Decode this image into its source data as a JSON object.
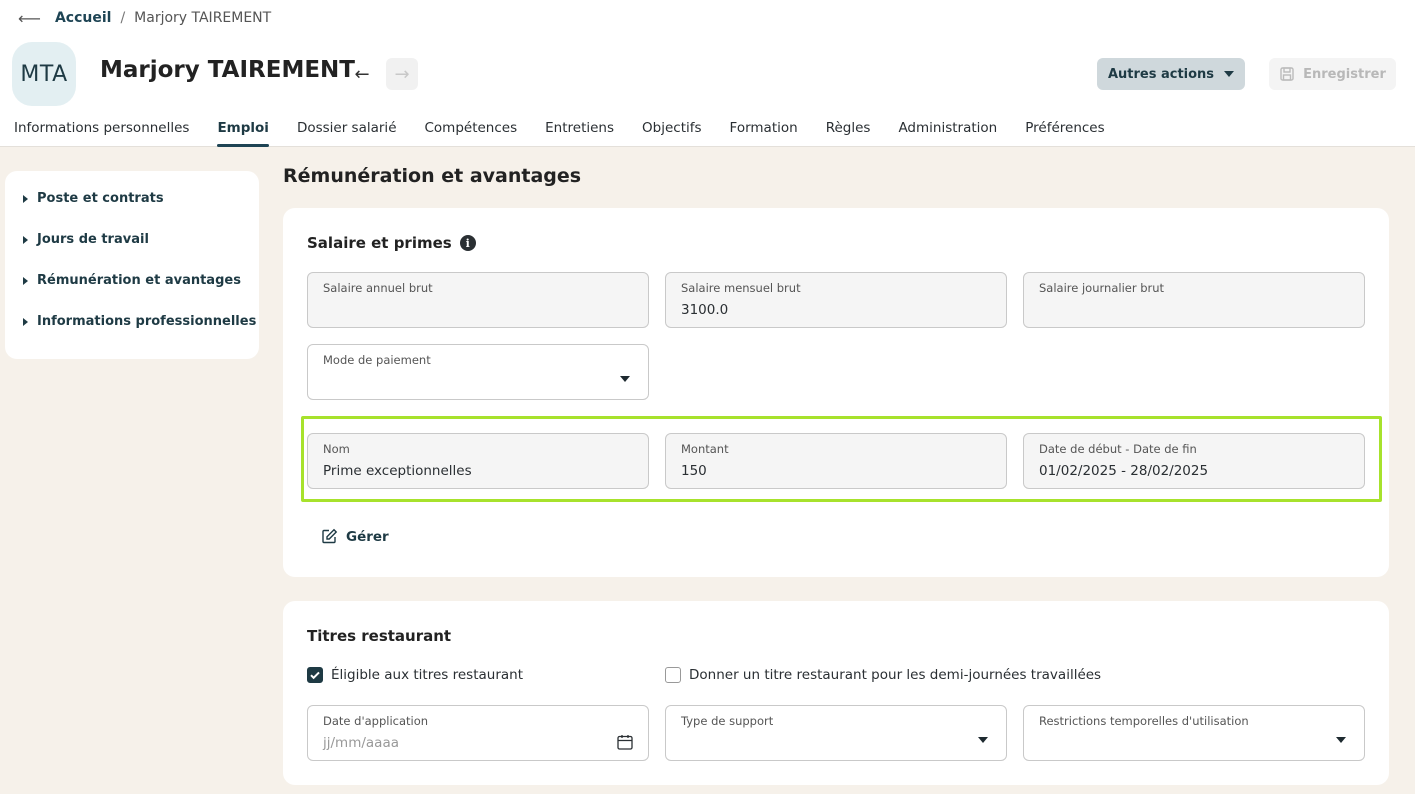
{
  "breadcrumb": {
    "home": "Accueil",
    "separator": "/",
    "current": "Marjory TAIREMENT"
  },
  "header": {
    "initials": "MTA",
    "name": "Marjory TAIREMENT",
    "prev_arrow": "←",
    "next_arrow": "→",
    "actions_label": "Autres actions",
    "save_label": "Enregistrer"
  },
  "tabs": [
    {
      "label": "Informations personnelles"
    },
    {
      "label": "Emploi",
      "active": true
    },
    {
      "label": "Dossier salarié"
    },
    {
      "label": "Compétences"
    },
    {
      "label": "Entretiens"
    },
    {
      "label": "Objectifs"
    },
    {
      "label": "Formation"
    },
    {
      "label": "Règles"
    },
    {
      "label": "Administration"
    },
    {
      "label": "Préférences"
    }
  ],
  "sidebar": {
    "items": [
      {
        "label": "Poste et contrats"
      },
      {
        "label": "Jours de travail"
      },
      {
        "label": "Rémunération et avantages"
      },
      {
        "label": "Informations professionnelles"
      }
    ]
  },
  "main": {
    "section_title": "Rémunération et avantages",
    "salary": {
      "title": "Salaire et primes",
      "annual": {
        "label": "Salaire annuel brut",
        "value": ""
      },
      "monthly": {
        "label": "Salaire mensuel brut",
        "value": "3100.0"
      },
      "daily": {
        "label": "Salaire journalier brut",
        "value": ""
      },
      "payment_mode": {
        "label": "Mode de paiement",
        "value": ""
      },
      "bonus": {
        "name": {
          "label": "Nom",
          "value": "Prime exceptionnelles"
        },
        "amount": {
          "label": "Montant",
          "value": "150"
        },
        "dates": {
          "label": "Date de début - Date de fin",
          "value": "01/02/2025 - 28/02/2025"
        }
      },
      "manage_label": "Gérer"
    },
    "meal": {
      "title": "Titres restaurant",
      "eligible": {
        "label": "Éligible aux titres restaurant",
        "checked": true
      },
      "half_days": {
        "label": "Donner un titre restaurant pour les demi-journées travaillées",
        "checked": false
      },
      "application_date": {
        "label": "Date d'application",
        "placeholder": "jj/mm/aaaa"
      },
      "support_type": {
        "label": "Type de support",
        "value": ""
      },
      "restrictions": {
        "label": "Restrictions temporelles d'utilisation",
        "value": ""
      }
    }
  },
  "colors": {
    "accent": "#1e4454",
    "highlight": "#a7e22c",
    "background": "#f6f1ea"
  }
}
